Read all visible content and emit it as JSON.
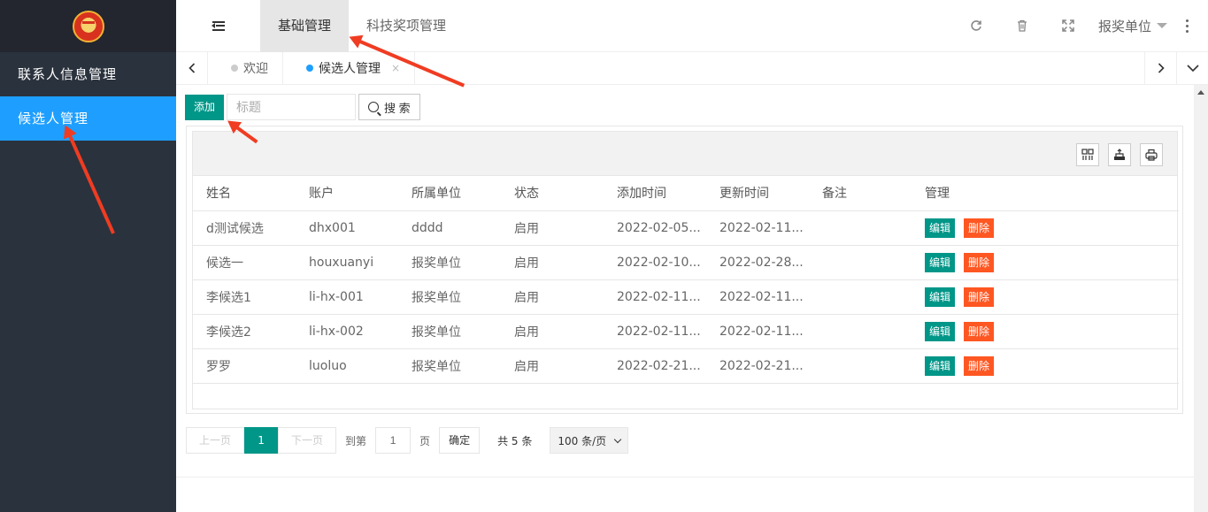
{
  "sidebar": {
    "items": [
      {
        "label": "联系人信息管理"
      },
      {
        "label": "候选人管理"
      }
    ]
  },
  "header": {
    "tabs": [
      {
        "label": "基础管理"
      },
      {
        "label": "科技奖项管理"
      }
    ],
    "user_label": "报奖单位"
  },
  "page_tabs": [
    {
      "label": "欢迎"
    },
    {
      "label": "候选人管理",
      "close": "×"
    }
  ],
  "toolbar": {
    "add_label": "添加",
    "search_placeholder": "标题",
    "search_label": "搜 索"
  },
  "table": {
    "columns": [
      "姓名",
      "账户",
      "所属单位",
      "状态",
      "添加时间",
      "更新时间",
      "备注",
      "管理"
    ],
    "edit_label": "编辑",
    "delete_label": "删除",
    "rows": [
      {
        "name": "d测试候选",
        "account": "dhx001",
        "unit": "dddd",
        "status": "启用",
        "added": "2022-02-05...",
        "updated": "2022-02-11...",
        "note": ""
      },
      {
        "name": "候选一",
        "account": "houxuanyi",
        "unit": "报奖单位",
        "status": "启用",
        "added": "2022-02-10...",
        "updated": "2022-02-28...",
        "note": ""
      },
      {
        "name": "李候选1",
        "account": "li-hx-001",
        "unit": "报奖单位",
        "status": "启用",
        "added": "2022-02-11...",
        "updated": "2022-02-11...",
        "note": ""
      },
      {
        "name": "李候选2",
        "account": "li-hx-002",
        "unit": "报奖单位",
        "status": "启用",
        "added": "2022-02-11...",
        "updated": "2022-02-11...",
        "note": ""
      },
      {
        "name": "罗罗",
        "account": "luoluo",
        "unit": "报奖单位",
        "status": "启用",
        "added": "2022-02-21...",
        "updated": "2022-02-21...",
        "note": ""
      }
    ]
  },
  "pager": {
    "prev_label": "上一页",
    "current_page": "1",
    "next_label": "下一页",
    "goto_label": "到第",
    "goto_value": "1",
    "page_unit": "页",
    "confirm_label": "确定",
    "total_label": "共 5 条",
    "page_size_label": "100 条/页"
  },
  "colors": {
    "sidebar_bg": "#2a323d",
    "active_nav": "#1e9fff",
    "primary_button": "#009688",
    "danger_button": "#ff5722",
    "annotation_arrow": "#f03c22"
  },
  "icons": [
    "fold-menu-icon",
    "refresh-icon",
    "trash-icon",
    "fullscreen-icon",
    "more-icon",
    "search-icon",
    "columns-icon",
    "export-icon",
    "print-icon"
  ]
}
